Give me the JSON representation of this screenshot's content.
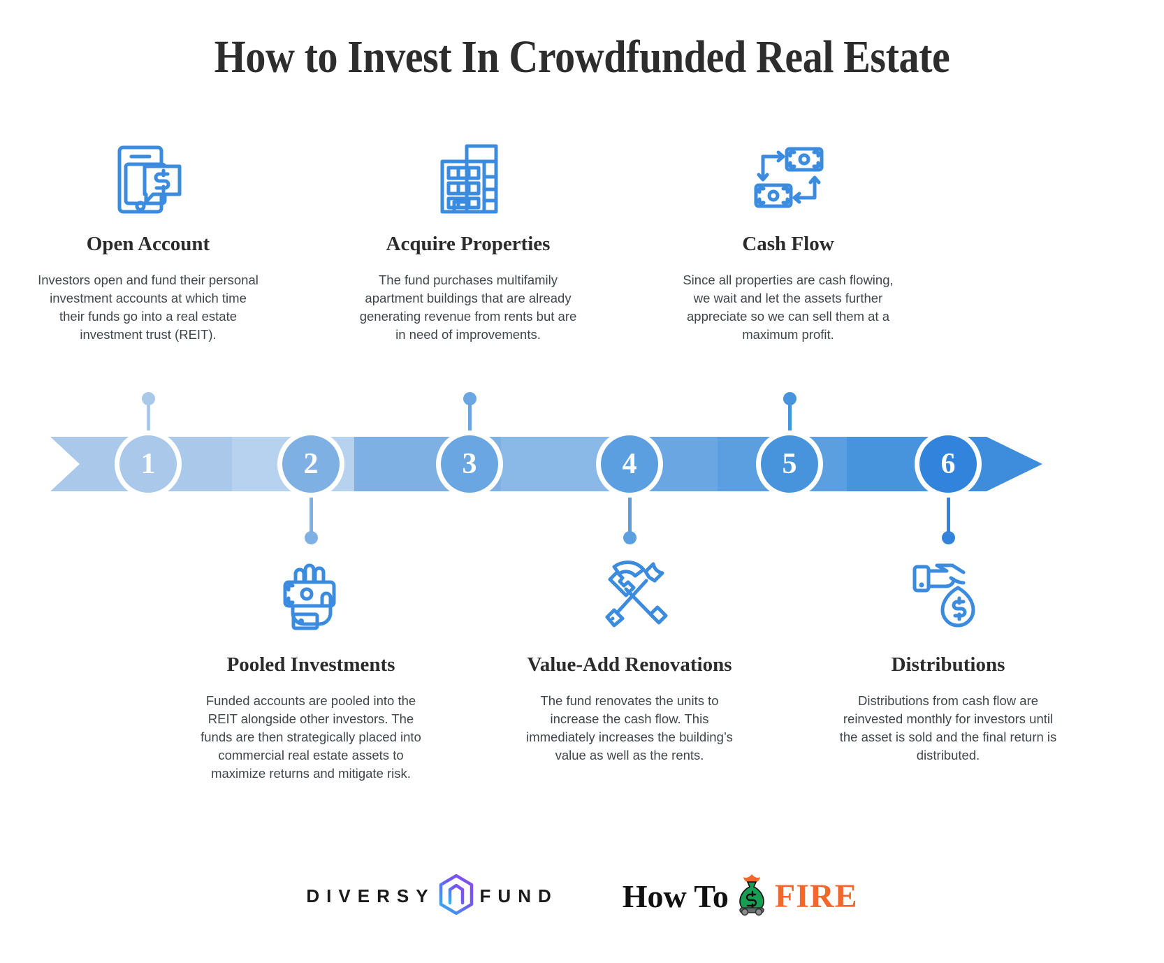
{
  "header": {
    "title": "How to Invest In Crowdfunded Real Estate"
  },
  "colors": {
    "accent_blue": "#3b8bdf",
    "banner_1": "#a9c8ea",
    "banner_2": "#b7d2ee",
    "banner_3": "#7fb0e4",
    "banner_4": "#8ab8e7",
    "banner_5": "#6aa6e2",
    "banner_6": "#6aa6e2",
    "banner_7": "#4f97de",
    "banner_8": "#3e8ddc",
    "marker_1": "#a9c8ea",
    "marker_2": "#7fb0e4",
    "marker_3": "#6aa6e2",
    "marker_4": "#5c9fe0",
    "marker_5": "#4794dd",
    "marker_6": "#3183dc",
    "title_color": "#2d2d2d",
    "body_color": "#404548",
    "fire_orange": "#f2682a",
    "fire_green": "#159e54"
  },
  "steps": [
    {
      "number": "1",
      "position": "top",
      "icon": "mobile-payment-icon",
      "title": "Open Account",
      "description": "Investors open and fund their personal investment accounts at which time their funds go into a real estate investment trust (REIT)."
    },
    {
      "number": "2",
      "position": "bottom",
      "icon": "hand-holding-cash-icon",
      "title": "Pooled Investments",
      "description": "Funded accounts are pooled into the REIT alongside other investors. The funds are then strategically placed into commercial real estate assets to maximize returns and mitigate risk."
    },
    {
      "number": "3",
      "position": "top",
      "icon": "apartment-building-icon",
      "title": "Acquire Properties",
      "description": "The fund purchases multifamily apartment buildings that are already generating revenue from rents but are in need of improvements."
    },
    {
      "number": "4",
      "position": "bottom",
      "icon": "hammer-wrench-icon",
      "title": "Value-Add Renovations",
      "description": "The fund renovates the units to increase the cash flow. This immediately increases the building’s value as well as the rents."
    },
    {
      "number": "5",
      "position": "top",
      "icon": "money-circulation-icon",
      "title": "Cash Flow",
      "description": "Since all properties are cash flowing, we wait and let the assets further appreciate so we can sell them at a maximum profit."
    },
    {
      "number": "6",
      "position": "bottom",
      "icon": "hand-money-bag-icon",
      "title": "Distributions",
      "description": "Distributions from cash flow are reinvested monthly for investors until the asset is sold and the final return is distributed."
    }
  ],
  "footer": {
    "diversy_word_1": "DIVERSY",
    "diversy_word_2": "FUND",
    "fire_word_1": "How To",
    "fire_word_2": "FIRE"
  }
}
